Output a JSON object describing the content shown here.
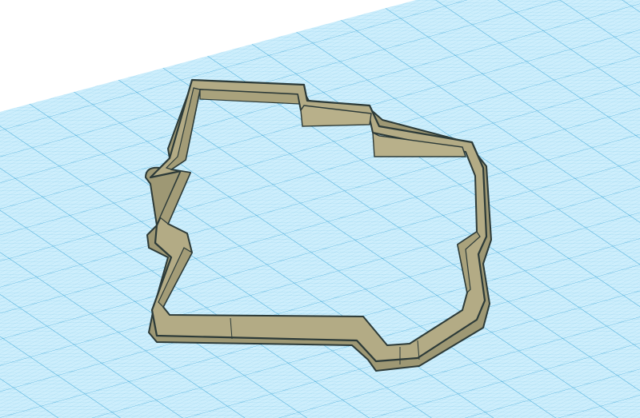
{
  "viewport": {
    "background_color": "#ffffff",
    "grid_color": "#3aa6d6",
    "grid_fill_color": "#c8ecfa",
    "model_wall_color": "#b3ab85",
    "model_edge_color": "#2c3a38",
    "model_shadow_color": "#8d8766"
  },
  "model": {
    "kind": "cookie-cutter-outline"
  }
}
